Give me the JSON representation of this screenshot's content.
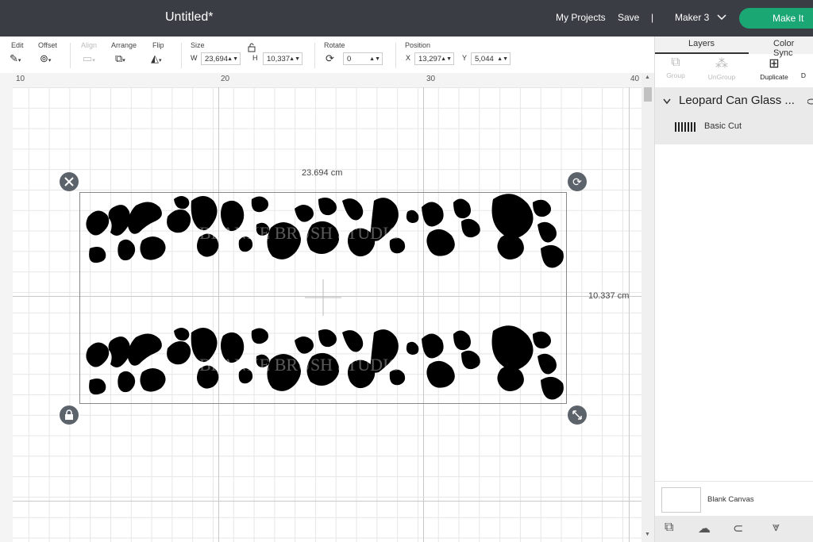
{
  "header": {
    "title": "Untitled*",
    "my_projects": "My Projects",
    "save": "Save",
    "divider": "|",
    "machine": "Maker 3",
    "make_it": "Make It"
  },
  "toolbar": {
    "edit": "Edit",
    "offset": "Offset",
    "align": "Align",
    "arrange": "Arrange",
    "flip": "Flip",
    "size": "Size",
    "w_label": "W",
    "w_value": "23,694",
    "h_label": "H",
    "h_value": "10,337",
    "rotate": "Rotate",
    "rotate_value": "0",
    "position": "Position",
    "x_label": "X",
    "x_value": "13,297",
    "y_label": "Y",
    "y_value": "5,044"
  },
  "ruler": {
    "marks": [
      "10",
      "20",
      "30",
      "40"
    ]
  },
  "canvas": {
    "width_label": "23.694 cm",
    "height_label": "10.337 cm",
    "watermark": "BLANKE BRUSH STUDIO"
  },
  "panel": {
    "tabs": [
      "Layers",
      "Color Sync"
    ],
    "tools": [
      "Group",
      "UnGroup",
      "Duplicate",
      "D"
    ],
    "layer_group_title": "Leopard Can Glass ...",
    "layer_item": "Basic Cut",
    "blank_canvas": "Blank Canvas"
  },
  "colors": {
    "topbar": "#3a3e44",
    "make_it": "#1aa774",
    "handle": "#5d636b"
  }
}
